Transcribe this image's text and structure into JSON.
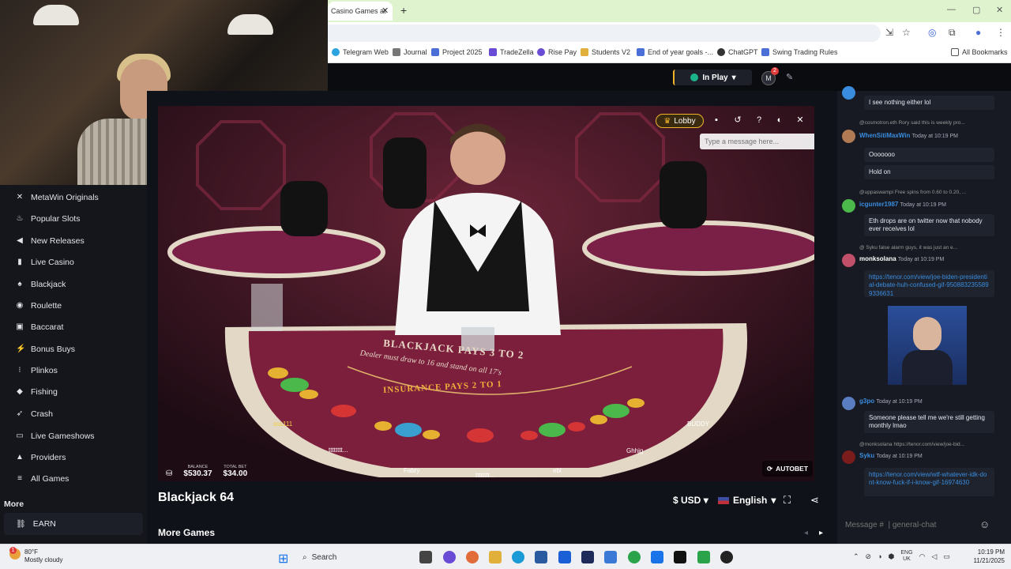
{
  "browser": {
    "tab_title": "Casino Games at ",
    "bookmarks": [
      {
        "label": "Telegram Web",
        "color": "#2aa3e0"
      },
      {
        "label": "Journal",
        "color": "#777777"
      },
      {
        "label": "Project 2025",
        "color": "#4a6fd6"
      },
      {
        "label": "TradeZella",
        "color": "#6a4bd6"
      },
      {
        "label": "Rise Pay",
        "color": "#6a4bd6"
      },
      {
        "label": "Students V2",
        "color": "#e0b03a"
      },
      {
        "label": "End of year goals -...",
        "color": "#4a6fd6"
      },
      {
        "label": "ChatGPT",
        "color": "#333333"
      },
      {
        "label": "Swing Trading Rules",
        "color": "#4a6fd6"
      }
    ],
    "all_bookmarks": "All Bookmarks"
  },
  "header": {
    "in_play": "In Play",
    "notification_count": "2"
  },
  "sidebar": {
    "items": [
      {
        "label": "MetaWin Originals",
        "icon": "metawin-icon",
        "glyph": "✕"
      },
      {
        "label": "Popular Slots",
        "icon": "flame-icon",
        "glyph": "♨"
      },
      {
        "label": "New Releases",
        "icon": "megaphone-icon",
        "glyph": "◀"
      },
      {
        "label": "Live Casino",
        "icon": "person-icon",
        "glyph": "▮"
      },
      {
        "label": "Blackjack",
        "icon": "spade-icon",
        "glyph": "♠"
      },
      {
        "label": "Roulette",
        "icon": "roulette-icon",
        "glyph": "◉"
      },
      {
        "label": "Baccarat",
        "icon": "cards-icon",
        "glyph": "▣"
      },
      {
        "label": "Bonus Buys",
        "icon": "lightning-icon",
        "glyph": "⚡"
      },
      {
        "label": "Plinkos",
        "icon": "plinko-icon",
        "glyph": "⁝"
      },
      {
        "label": "Fishing",
        "icon": "fish-icon",
        "glyph": "◆"
      },
      {
        "label": "Crash",
        "icon": "rocket-icon",
        "glyph": "➶"
      },
      {
        "label": "Live Gameshows",
        "icon": "tv-icon",
        "glyph": "▭"
      },
      {
        "label": "Providers",
        "icon": "providers-icon",
        "glyph": "▲"
      },
      {
        "label": "All Games",
        "icon": "stack-icon",
        "glyph": "≡"
      }
    ],
    "more_title": "More",
    "earn": "EARN"
  },
  "game": {
    "lobby": "Lobby",
    "message_placeholder": "Type a message here...",
    "balance_label": "BALANCE",
    "balance_value": "$530.37",
    "total_bet_label": "TOTAL BET",
    "total_bet_value": "$34.00",
    "autobet": "AUTOBET",
    "table_text_1": "BLACKJACK PAYS 3 TO 2",
    "table_text_2": "Dealer must draw to 16 and stand on all 17's",
    "table_text_3": "INSURANCE PAYS 2 TO 1",
    "seats": [
      "sss111",
      "tttttttt...",
      "Fabry",
      "tttttttt...",
      "ebl",
      "Ghhjg",
      "BUDDY"
    ],
    "title": "Blackjack 64",
    "currency": "$ USD",
    "language": "English",
    "more_games": "More Games"
  },
  "chat": {
    "messages": [
      {
        "type": "bubble",
        "text": "I see nothing either lol"
      },
      {
        "type": "reply",
        "text": "@cosmotron.eth  Rory said this is weekly pro..."
      },
      {
        "type": "user",
        "user": "WhenSitiMaxWin",
        "time": "Today at 10:19 PM",
        "color": "#3a8dde"
      },
      {
        "type": "bubble",
        "text": "Ooooooo"
      },
      {
        "type": "bubble",
        "text": "Hold on"
      },
      {
        "type": "reply",
        "text": "@uppaswampi  Free spins from 0.60 to 0.20, ..."
      },
      {
        "type": "user",
        "user": "icgunter1987",
        "time": "Today at 10:19 PM",
        "color": "#3a8dde"
      },
      {
        "type": "bubble",
        "text": "Eth drops are on twitter now that nobody ever receives lol"
      },
      {
        "type": "reply",
        "text": "@ Syku  false alarm guys, it was just an e..."
      },
      {
        "type": "user",
        "user": "monksolana",
        "time": "Today at 10:19 PM",
        "color": "#ffffff"
      },
      {
        "type": "link",
        "text": "https://tenor.com/view/joe-biden-presidential-debate-huh-confused-gif-9508832355899336631"
      },
      {
        "type": "user",
        "user": "g3po",
        "time": "Today at 10:19 PM",
        "color": "#3a8dde"
      },
      {
        "type": "bubble",
        "text": "Someone please tell me we're still getting monthly lmao"
      },
      {
        "type": "reply",
        "text": "@monksolana  https://tenor.com/view/joe-bid..."
      },
      {
        "type": "user",
        "user": "Syku",
        "time": "Today at 10:19 PM",
        "color": "#3a8dde"
      },
      {
        "type": "link",
        "text": "https://tenor.com/view/wtf-whatever-idk-dont-know-fuck-if-i-know-gif-16974630"
      }
    ],
    "input_placeholder": "Message #  | general-chat"
  },
  "taskbar": {
    "weather_temp": "80°F",
    "weather_desc": "Mostly cloudy",
    "weather_badge": "1",
    "search": "Search",
    "lang_1": "ENG",
    "lang_2": "UK",
    "time": "10:19 PM",
    "date": "11/21/2025"
  }
}
